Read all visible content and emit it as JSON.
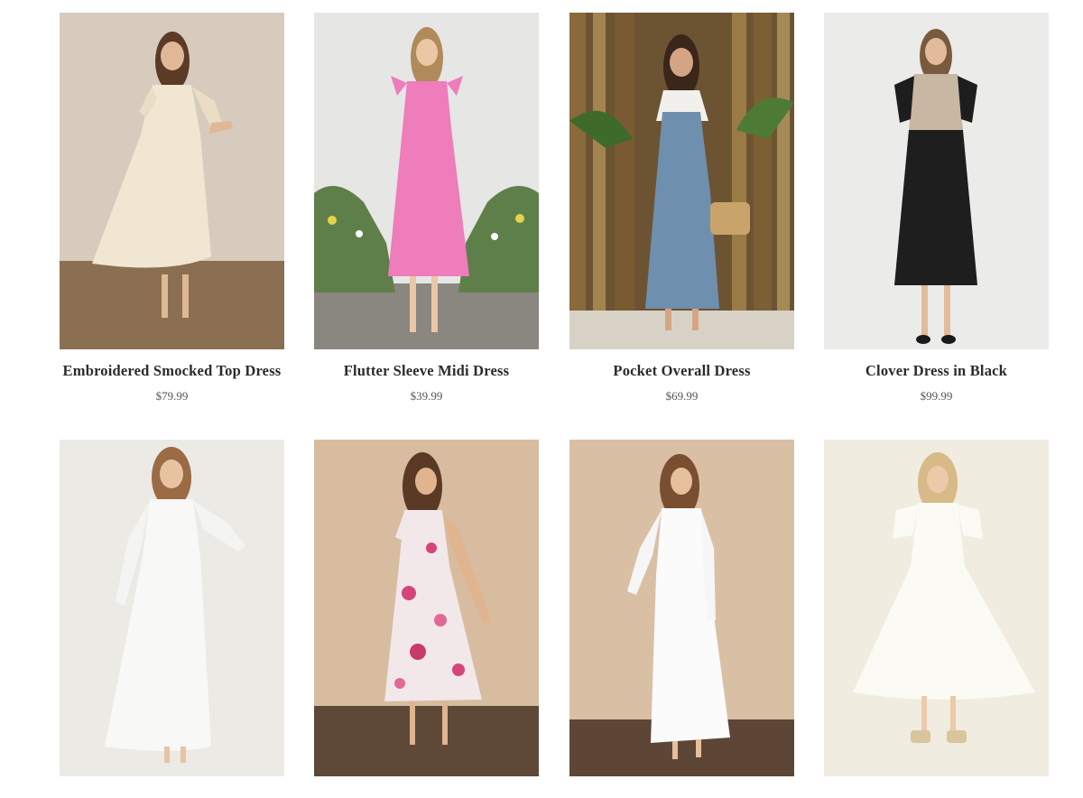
{
  "products": [
    {
      "name": "Embroidered Smocked Top Dress",
      "price": "$79.99"
    },
    {
      "name": "Flutter Sleeve Midi Dress",
      "price": "$39.99"
    },
    {
      "name": "Pocket Overall Dress",
      "price": "$69.99"
    },
    {
      "name": "Clover Dress in Black",
      "price": "$99.99"
    },
    {
      "name": "",
      "price": ""
    },
    {
      "name": "",
      "price": ""
    },
    {
      "name": "",
      "price": ""
    },
    {
      "name": "",
      "price": ""
    }
  ]
}
